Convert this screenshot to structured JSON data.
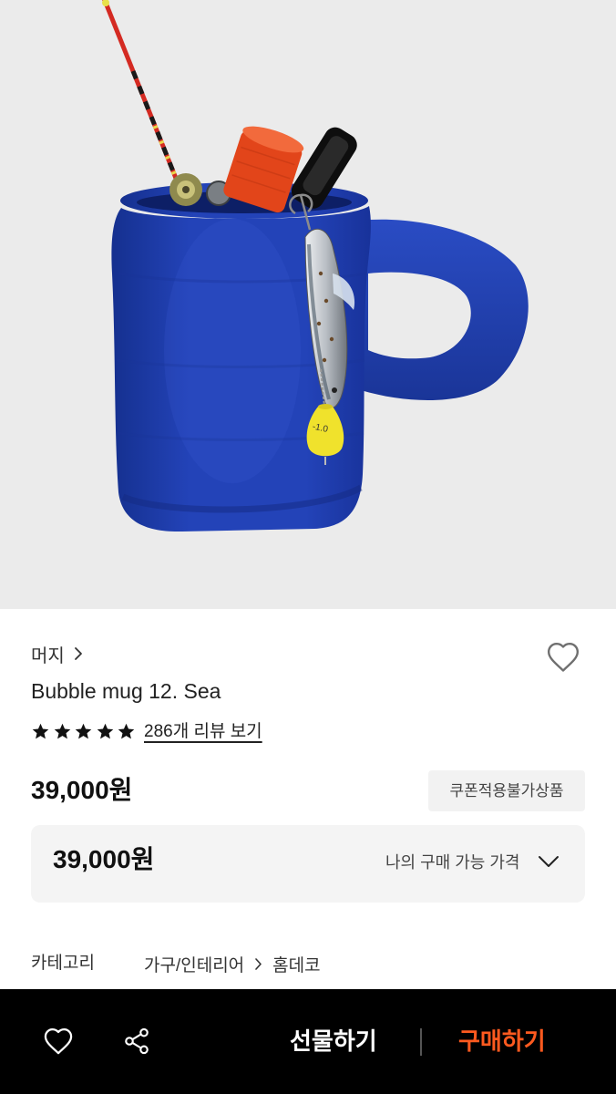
{
  "colors": {
    "hero_background": "#ebebeb",
    "mug_blue": "#2343b8",
    "accent": "#ff5a1f",
    "bottom_bar": "#000000"
  },
  "product_image": {
    "bobber_mark": "-1.0"
  },
  "header": {
    "brand_name": "머지",
    "brand_icon": "chevron-right-icon",
    "wishlist_icon": "heart-icon"
  },
  "product": {
    "title": "Bubble mug 12. Sea",
    "rating": 5,
    "rating_max": 5,
    "star_icon": "star-icon",
    "review_link": "286개 리뷰 보기",
    "price": "39,000원",
    "coupon_badge": "쿠폰적용불가상품"
  },
  "my_price": {
    "price": "39,000원",
    "label": "나의 구매 가능 가격",
    "toggle_icon": "chevron-down-icon"
  },
  "category": {
    "label": "카테고리",
    "path": [
      "가구/인테리어",
      "홈데코"
    ],
    "separator_icon": "chevron-right-icon"
  },
  "bottom_bar": {
    "like_icon": "heart-icon",
    "share_icon": "share-icon",
    "gift_label": "선물하기",
    "buy_label": "구매하기"
  }
}
